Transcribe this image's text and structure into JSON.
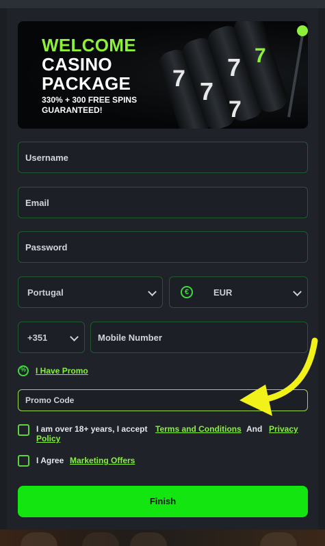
{
  "banner": {
    "line1": "WELCOME",
    "line2": "CASINO",
    "line3": "PACKAGE",
    "line4": "330% + 300 FREE SPINS",
    "line5": "GUARANTEED!",
    "slot_symbol": "7"
  },
  "form": {
    "username_placeholder": "Username",
    "email_placeholder": "Email",
    "password_placeholder": "Password",
    "country_value": "Portugal",
    "currency_value": "EUR",
    "currency_icon": "€",
    "dial_code_value": "+351",
    "mobile_placeholder": "Mobile Number",
    "promo_link": "I Have Promo",
    "promo_placeholder": "Promo Code",
    "terms_text_1": "I am over 18+ years, I accept",
    "terms_link": "Terms and Conditions",
    "terms_and": "And",
    "privacy_link_1": "Privacy",
    "privacy_link_2": "Policy",
    "agree_text": "I Agree",
    "marketing_link": "Marketing Offers",
    "finish_label": "Finish"
  },
  "colors": {
    "accent_green": "#12e50f",
    "link_green": "#86f23a",
    "annotation_arrow": "#f2f21a"
  }
}
